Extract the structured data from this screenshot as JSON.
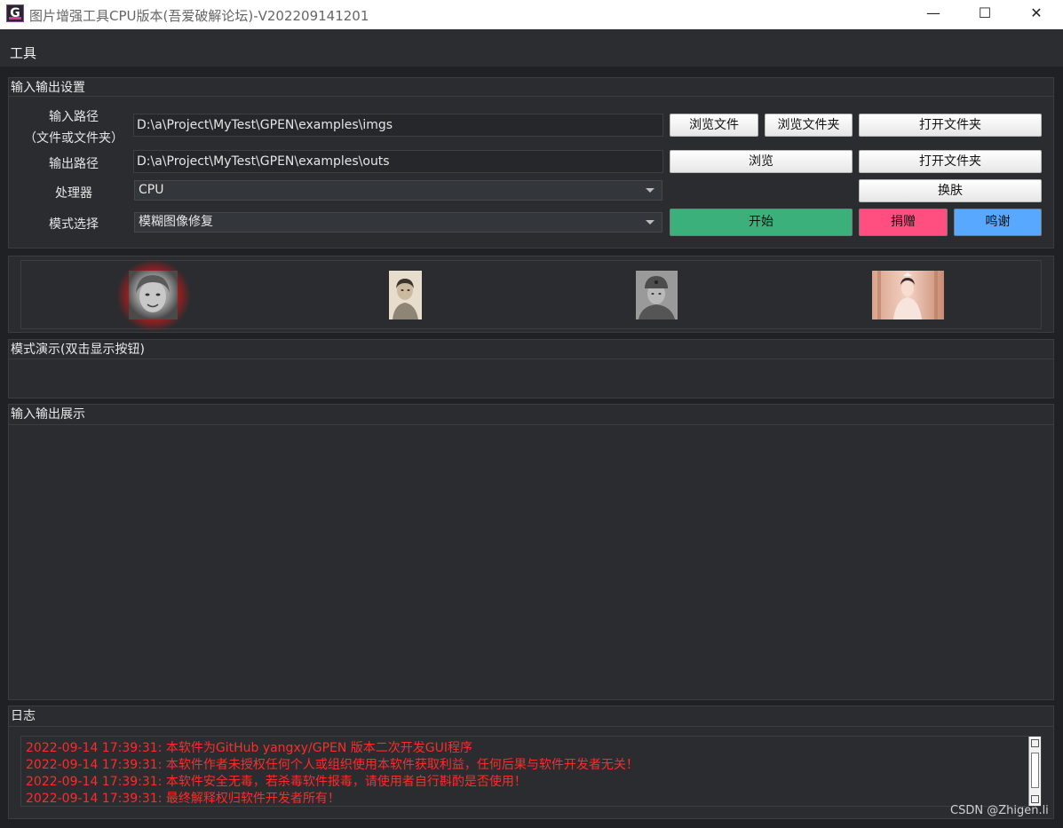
{
  "window": {
    "icon_letter": "G",
    "title": "图片增强工具CPU版本(吾爱破解论坛)-V202209141201",
    "minimize": "—",
    "maximize": "☐",
    "close": "✕"
  },
  "menu": {
    "tools": "工具"
  },
  "io_settings": {
    "title": "输入输出设置",
    "input_label_line1": "输入路径",
    "input_label_line2": "（文件或文件夹）",
    "input_value": "D:\\a\\Project\\MyTest\\GPEN\\examples\\imgs",
    "browse_file": "浏览文件",
    "browse_folder": "浏览文件夹",
    "open_folder_1": "打开文件夹",
    "output_label": "输出路径",
    "output_value": "D:\\a\\Project\\MyTest\\GPEN\\examples\\outs",
    "browse": "浏览",
    "open_folder_2": "打开文件夹",
    "processor_label": "处理器",
    "processor_value": "CPU",
    "skin_button": "换肤",
    "mode_label": "模式选择",
    "mode_value": "模糊图像修复",
    "start_button": "开始",
    "donate_button": "捐赠",
    "thanks_button": "鸣谢"
  },
  "thumbnails": [
    {
      "name": "thumb-girl-bw",
      "selected": true
    },
    {
      "name": "thumb-woman-old-photo",
      "selected": false
    },
    {
      "name": "thumb-soldier-bw",
      "selected": false
    },
    {
      "name": "thumb-bride-color",
      "selected": false
    }
  ],
  "mode_demo": {
    "title": "模式演示(双击显示按钮)"
  },
  "io_display": {
    "title": "输入输出展示"
  },
  "log": {
    "title": "日志",
    "lines": [
      "2022-09-14 17:39:31: 本软件为GitHub yangxy/GPEN 版本二次开发GUI程序",
      "2022-09-14 17:39:31: 本软件作者未授权任何个人或组织使用本软件获取利益，任何后果与软件开发者无关！",
      "2022-09-14 17:39:31: 本软件安全无毒，若杀毒软件报毒，请使用者自行斟酌是否使用！",
      "2022-09-14 17:39:31: 最终解释权归软件开发者所有！"
    ]
  },
  "watermark": "CSDN @Zhigen.li",
  "colors": {
    "start": "#3bb07a",
    "donate": "#ff4f80",
    "thanks": "#58a8ff",
    "log_text": "#ff2a2a",
    "selected_glow": "#d01818"
  }
}
